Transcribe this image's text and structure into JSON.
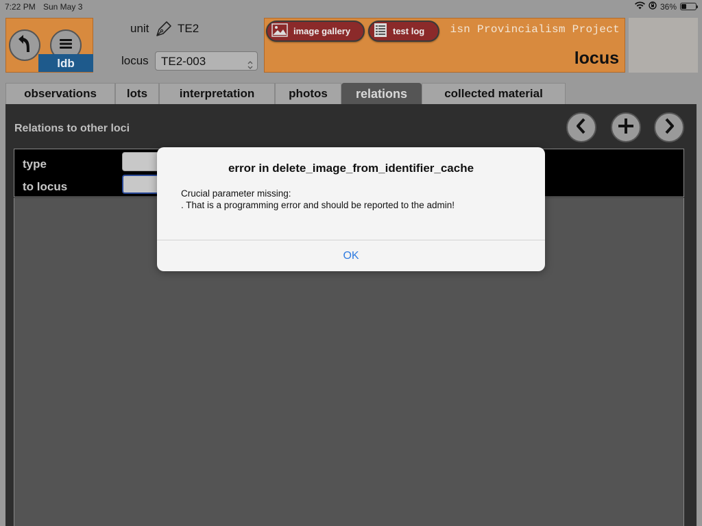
{
  "status_bar": {
    "time": "7:22 PM",
    "date": "Sun May 3",
    "battery_percent": "36%",
    "battery_level": 0.36,
    "icons": [
      "wifi-icon",
      "orientation-lock-icon",
      "battery-icon"
    ]
  },
  "header": {
    "back_icon": "back-arrow-icon",
    "menu_icon": "hamburger-menu-icon",
    "badge_label": "ldb",
    "unit_label": "unit",
    "unit_icon": "pen-nib-icon",
    "unit_value": "TE2",
    "locus_label": "locus",
    "locus_value": "TE2-003",
    "banner_project_text": "isn Provincialism Project",
    "banner_title": "locus",
    "image_gallery_label": "image gallery",
    "test_log_label": "test log",
    "colors": {
      "banner": "#d88a3e",
      "pill": "#8b2a2a",
      "badge": "#1e5a8c"
    }
  },
  "tabs": [
    {
      "label": "observations",
      "active": false
    },
    {
      "label": "lots",
      "active": false
    },
    {
      "label": "interpretation",
      "active": false
    },
    {
      "label": "photos",
      "active": false
    },
    {
      "label": "relations",
      "active": true
    },
    {
      "label": "collected material",
      "active": false
    }
  ],
  "main": {
    "section_title": "Relations to other loci",
    "nav_icons": [
      "chevron-left-icon",
      "plus-icon",
      "chevron-right-icon"
    ],
    "form": {
      "type_label": "type",
      "to_locus_label": "to locus",
      "type_value": "",
      "to_locus_value": ""
    }
  },
  "alert": {
    "title": "error in delete_image_from_identifier_cache",
    "message_line1": "Crucial parameter missing:",
    "message_line2": ". That is a programming error and should be reported to the admin!",
    "ok_label": "OK",
    "ok_color": "#2f7be0"
  }
}
